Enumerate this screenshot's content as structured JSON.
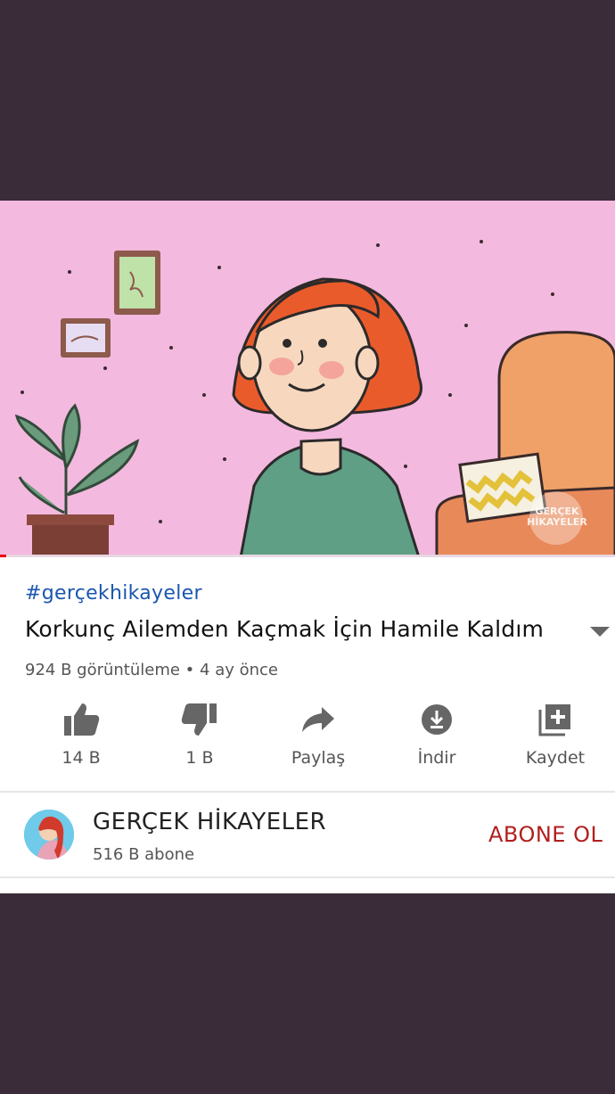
{
  "video": {
    "watermark_line1": "GERÇEK",
    "watermark_line2": "HİKAYELER",
    "progress_fraction": 0.01
  },
  "hashtag": "#gerçekhikayeler",
  "title": "Korkunç Ailemden Kaçmak İçin Hamile Kaldım",
  "meta": "924 B görüntüleme • 4 ay önce",
  "actions": [
    {
      "label": "14 B",
      "icon": "like-icon"
    },
    {
      "label": "1 B",
      "icon": "dislike-icon"
    },
    {
      "label": "Paylaş",
      "icon": "share-icon"
    },
    {
      "label": "İndir",
      "icon": "download-icon"
    },
    {
      "label": "Kaydet",
      "icon": "save-icon"
    }
  ],
  "channel": {
    "name": "GERÇEK HİKAYELER",
    "subscribers": "516 B abone",
    "subscribe_label": "ABONE OL"
  },
  "colors": {
    "background": "#3b2c39",
    "video_bg": "#f2b8dc",
    "hashtag": "#1a56b0",
    "subscribe": "#b31e1e"
  }
}
